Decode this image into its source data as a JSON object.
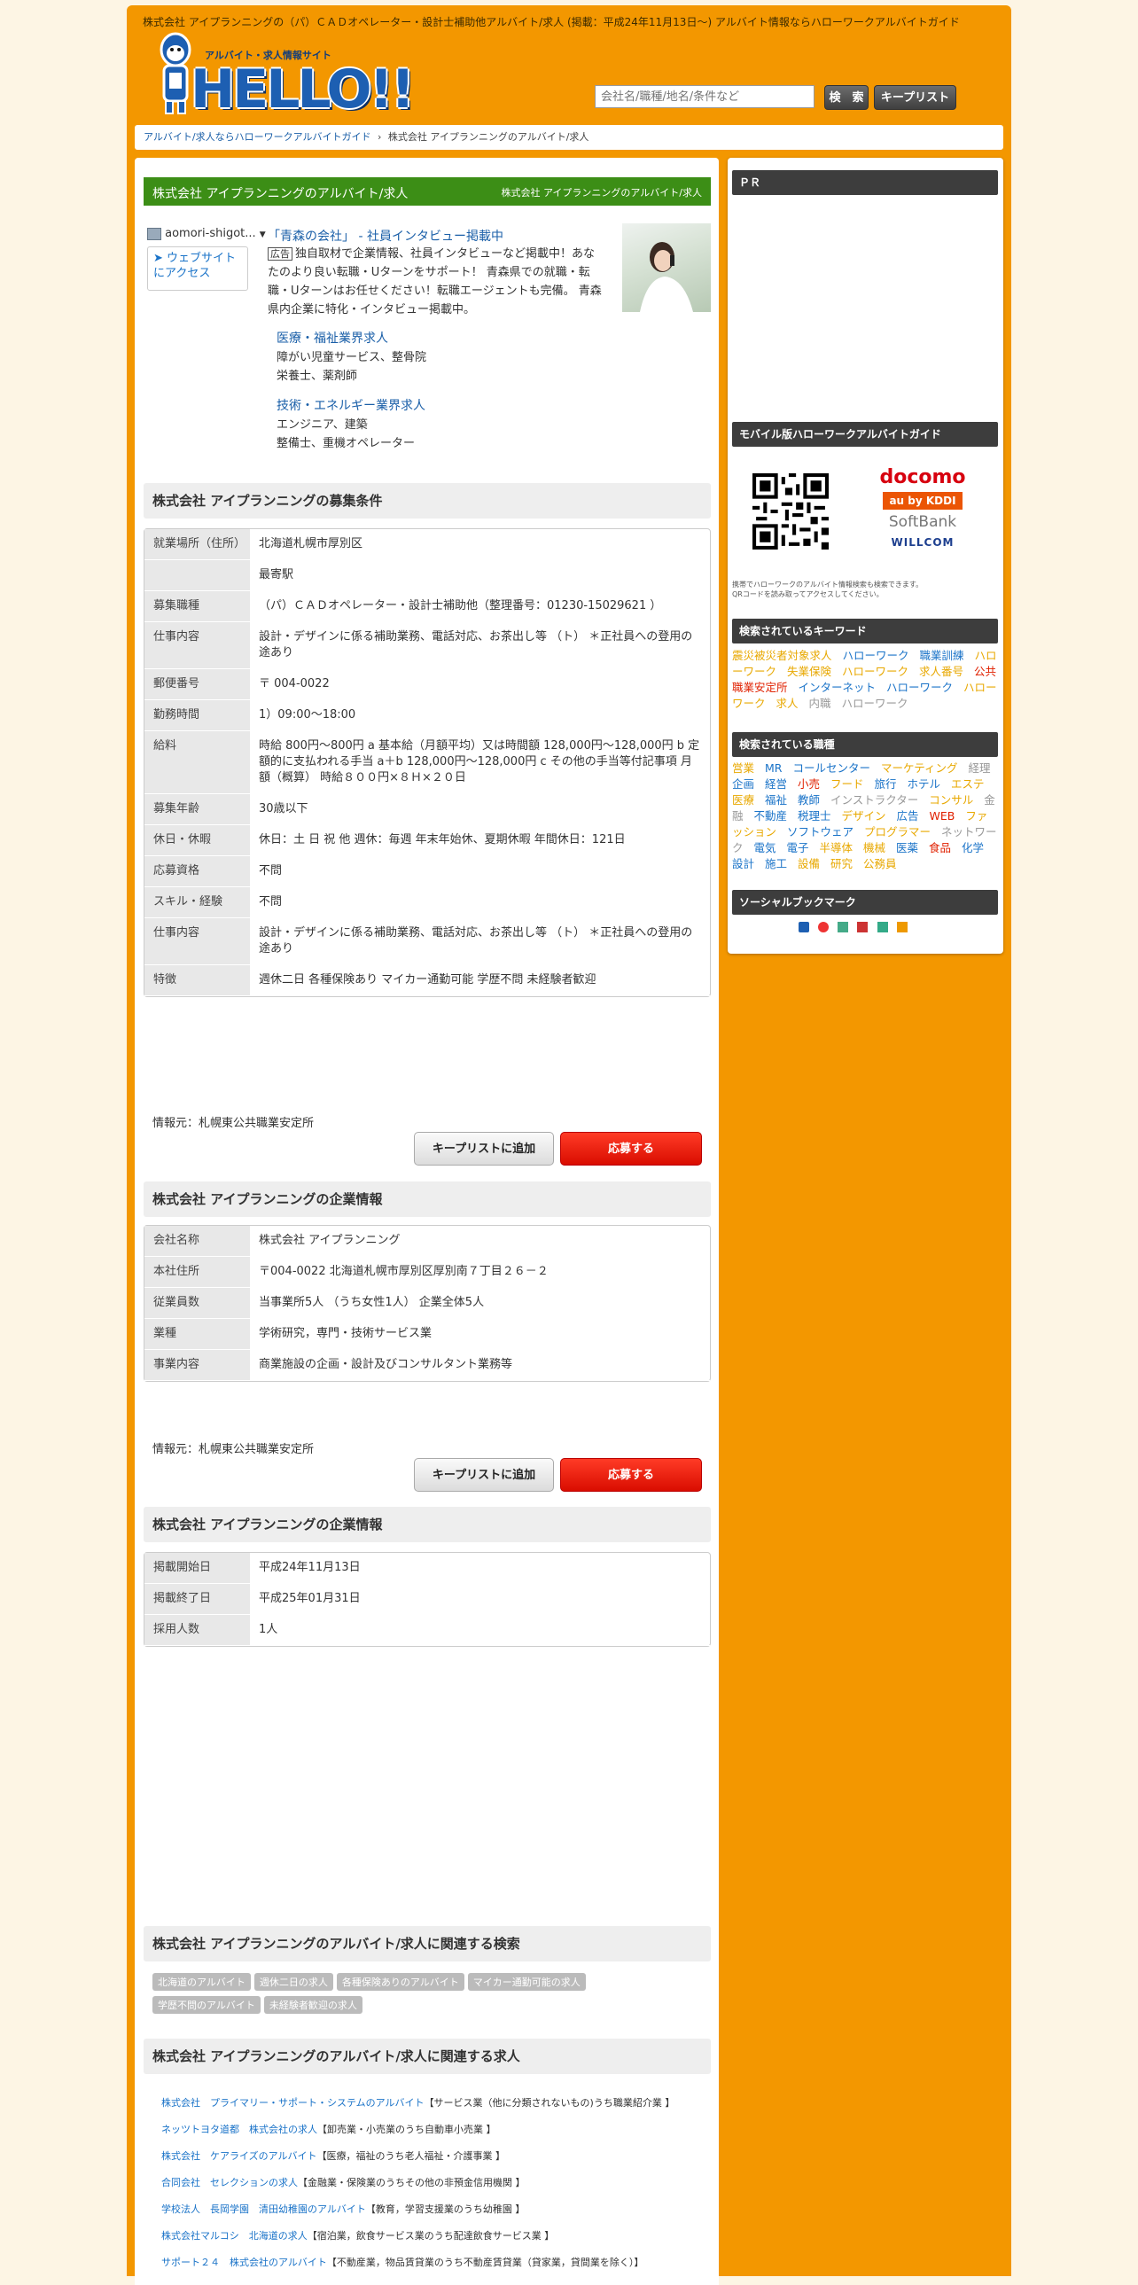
{
  "header": {
    "title": "株式会社 アイプランニングの（パ）ＣＡＤオペレーター・設計士補助他アルバイト/求人 (掲載：平成24年11月13日～) アルバイト情報ならハローワークアルバイトガイド",
    "logo_sub": "アルバイト・求人情報サイト",
    "logo_word": "HELLO!!",
    "search_placeholder": "会社名/職種/地名/条件など",
    "search_label": "検　索",
    "keeplist_label": "キープリスト"
  },
  "breadcrumb": {
    "home": "アルバイト/求人ならハローワークアルバイトガイド",
    "sep": "›",
    "current": "株式会社 アイプランニングのアルバイト/求人"
  },
  "title_bar": {
    "main": "株式会社 アイプランニングのアルバイト/求人",
    "sub": "株式会社 アイプランニングのアルバイト/求人"
  },
  "ad": {
    "source": "aomori-shigot...",
    "visit": "➤ ウェブサイトにアクセス",
    "title": "「青森の会社」 - 社員インタビュー掲載中",
    "badge": "広告",
    "body": "独自取材で企業情報、社員インタビューなど掲載中！あなたのより良い転職・Uターンをサポート！ 青森県での就職・転職・Uターンはお任せください！転職エージェントも完備。 青森県内企業に特化・インタビュー掲載中。",
    "sub1_title": "医療・福祉業界求人",
    "sub1_l1": "障がい児童サービス、整骨院",
    "sub1_l2": "栄養士、薬剤師",
    "sub2_title": "技術・エネルギー業界求人",
    "sub2_l1": "エンジニア、建築",
    "sub2_l2": "整備士、重機オペレーター"
  },
  "recruit": {
    "heading": "株式会社 アイプランニングの募集条件",
    "rows": [
      {
        "k": "就業場所（住所）",
        "v": "北海道札幌市厚別区"
      },
      {
        "k": "",
        "v": "最寄駅"
      },
      {
        "k": "募集職種",
        "v": "（パ）ＣＡＤオペレーター・設計士補助他（整理番号：01230-15029621 ）"
      },
      {
        "k": "仕事内容",
        "v": "設計・デザインに係る補助業務、電話対応、お茶出し等 （ト） ＊正社員への登用の途あり"
      },
      {
        "k": "郵便番号",
        "v": "〒 004-0022"
      },
      {
        "k": "勤務時間",
        "v": "1）09:00～18:00"
      },
      {
        "k": "給料",
        "v": "時給 800円～800円 a 基本給（月額平均）又は時間額 128,000円～128,000円 b 定額的に支払われる手当 a＋b 128,000円～128,000円 c その他の手当等付記事項 月額（概算） 時給８００円×８Ｈ×２０日"
      },
      {
        "k": "募集年齢",
        "v": "30歳以下"
      },
      {
        "k": "休日・休暇",
        "v": "休日：土 日 祝 他 週休：毎週 年末年始休、夏期休暇 年間休日：121日"
      },
      {
        "k": "応募資格",
        "v": "不問"
      },
      {
        "k": "スキル・経験",
        "v": "不問"
      },
      {
        "k": "仕事内容",
        "v": "設計・デザインに係る補助業務、電話対応、お茶出し等 （ト） ＊正社員への登用の途あり"
      },
      {
        "k": "特徴",
        "v": "週休二日 各種保険あり マイカー通勤可能 学歴不問 未経験者歓迎"
      }
    ],
    "source": "情報元：札幌東公共職業安定所"
  },
  "company": {
    "heading": "株式会社 アイプランニングの企業情報",
    "rows": [
      {
        "k": "会社名称",
        "v": "株式会社 アイプランニング"
      },
      {
        "k": "本社住所",
        "v": "〒004-0022 北海道札幌市厚別区厚別南７丁目２６－２"
      },
      {
        "k": "従業員数",
        "v": "当事業所5人 （うち女性1人） 企業全体5人"
      },
      {
        "k": "業種",
        "v": "学術研究，専門・技術サービス業"
      },
      {
        "k": "事業内容",
        "v": "商業施設の企画・設計及びコンサルタント業務等"
      }
    ],
    "source": "情報元：札幌東公共職業安定所"
  },
  "posting": {
    "heading": "株式会社 アイプランニングの企業情報",
    "rows": [
      {
        "k": "掲載開始日",
        "v": "平成24年11月13日"
      },
      {
        "k": "掲載終了日",
        "v": "平成25年01月31日"
      },
      {
        "k": "採用人数",
        "v": "1人"
      }
    ]
  },
  "buttons": {
    "keep": "キープリストに追加",
    "apply": "応募する"
  },
  "related_search": {
    "heading": "株式会社 アイプランニングのアルバイト/求人に関連する検索",
    "tags": [
      "北海道のアルバイト",
      "週休二日の求人",
      "各種保険ありのアルバイト",
      "マイカー通勤可能の求人",
      "学歴不問のアルバイト",
      "未経験者歓迎の求人"
    ]
  },
  "related_jobs": {
    "heading": "株式会社 アイプランニングのアルバイト/求人に関連する求人",
    "items": [
      {
        "link": "株式会社　プライマリー・サポート・システムのアルバイト",
        "cat": "【サービス業（他に分類されないもの)うち職業紹介業 】"
      },
      {
        "link": "ネッツトヨタ道都　株式会社の求人",
        "cat": "【卸売業・小売業のうち自動車小売業 】"
      },
      {
        "link": "株式会社　ケアライズのアルバイト",
        "cat": "【医療，福祉のうち老人福祉・介護事業 】"
      },
      {
        "link": "合同会社　セレクションの求人",
        "cat": "【金融業・保険業のうちその他の非預金信用機関 】"
      },
      {
        "link": "学校法人　長岡学園　清田幼稚園のアルバイト",
        "cat": "【教育，学習支援業のうち幼稚園 】"
      },
      {
        "link": "株式会社マルコシ　北海道の求人",
        "cat": "【宿泊業，飲食サービス業のうち配達飲食サービス業 】"
      },
      {
        "link": "サポート２４　株式会社のアルバイト",
        "cat": "【不動産業，物品賃貸業のうち不動産賃貸業（貸家業，貸間業を除く）】"
      }
    ]
  },
  "sidebar": {
    "pr": "ＰＲ",
    "mobile_heading": "モバイル版ハローワークアルバイトガイド",
    "carriers": [
      "docomo",
      "au by KDDI",
      "SoftBank",
      "WILLCOM"
    ],
    "mobile_note1": "携帯でハローワークのアルバイト情報検索も検索できます。",
    "mobile_note2": "QRコードを読み取ってアクセスしてください。",
    "kw_heading": "検索されているキーワード",
    "keywords": [
      {
        "t": "震災被災者対象求人",
        "c": "#e8a800"
      },
      {
        "t": "ハローワーク",
        "c": "#1a73c8"
      },
      {
        "t": "職業訓練",
        "c": "#1a73c8"
      },
      {
        "t": "ハローワーク",
        "c": "#e8a800"
      },
      {
        "t": "失業保険",
        "c": "#e8a800"
      },
      {
        "t": "ハローワーク",
        "c": "#e8a800"
      },
      {
        "t": "求人番号",
        "c": "#e8a800"
      },
      {
        "t": "公共職業安定所",
        "c": "#e02000"
      },
      {
        "t": "インターネット",
        "c": "#1a73c8"
      },
      {
        "t": "ハローワーク",
        "c": "#1a73c8"
      },
      {
        "t": "ハローワーク",
        "c": "#e8a800"
      },
      {
        "t": "求人",
        "c": "#e8a800"
      },
      {
        "t": "内職",
        "c": "#999999"
      },
      {
        "t": "ハローワーク",
        "c": "#999999"
      }
    ],
    "jobs_heading": "検索されている職種",
    "jobs": [
      {
        "t": "営業",
        "c": "#e8a800"
      },
      {
        "t": "MR",
        "c": "#1a73c8"
      },
      {
        "t": "コールセンター",
        "c": "#1a73c8"
      },
      {
        "t": "マーケティング",
        "c": "#e8a800"
      },
      {
        "t": "経理",
        "c": "#999999"
      },
      {
        "t": "企画",
        "c": "#1a73c8"
      },
      {
        "t": "経営",
        "c": "#1a73c8"
      },
      {
        "t": "小売",
        "c": "#e02000"
      },
      {
        "t": "フード",
        "c": "#e8a800"
      },
      {
        "t": "旅行",
        "c": "#1a73c8"
      },
      {
        "t": "ホテル",
        "c": "#1a73c8"
      },
      {
        "t": "エステ",
        "c": "#e8a800"
      },
      {
        "t": "医療",
        "c": "#e8a800"
      },
      {
        "t": "福祉",
        "c": "#1a73c8"
      },
      {
        "t": "教師",
        "c": "#1a73c8"
      },
      {
        "t": "インストラクター",
        "c": "#999999"
      },
      {
        "t": "コンサル",
        "c": "#e8a800"
      },
      {
        "t": "金融",
        "c": "#999999"
      },
      {
        "t": "不動産",
        "c": "#1a73c8"
      },
      {
        "t": "税理士",
        "c": "#1a73c8"
      },
      {
        "t": "デザイン",
        "c": "#e8a800"
      },
      {
        "t": "広告",
        "c": "#1a73c8"
      },
      {
        "t": "WEB",
        "c": "#e02000"
      },
      {
        "t": "ファッション",
        "c": "#e8a800"
      },
      {
        "t": "ソフトウェア",
        "c": "#1a73c8"
      },
      {
        "t": "プログラマー",
        "c": "#e8a800"
      },
      {
        "t": "ネットワーク",
        "c": "#999999"
      },
      {
        "t": "電気",
        "c": "#1a73c8"
      },
      {
        "t": "電子",
        "c": "#1a73c8"
      },
      {
        "t": "半導体",
        "c": "#e8a800"
      },
      {
        "t": "機械",
        "c": "#e8a800"
      },
      {
        "t": "医薬",
        "c": "#1a73c8"
      },
      {
        "t": "食品",
        "c": "#e02000"
      },
      {
        "t": "化学",
        "c": "#1a73c8"
      },
      {
        "t": "設計",
        "c": "#1a73c8"
      },
      {
        "t": "施工",
        "c": "#1a73c8"
      },
      {
        "t": "設備",
        "c": "#e8a800"
      },
      {
        "t": "研究",
        "c": "#e8a800"
      },
      {
        "t": "公務員",
        "c": "#e8a800"
      }
    ],
    "social_heading": "ソーシャルブックマーク"
  }
}
